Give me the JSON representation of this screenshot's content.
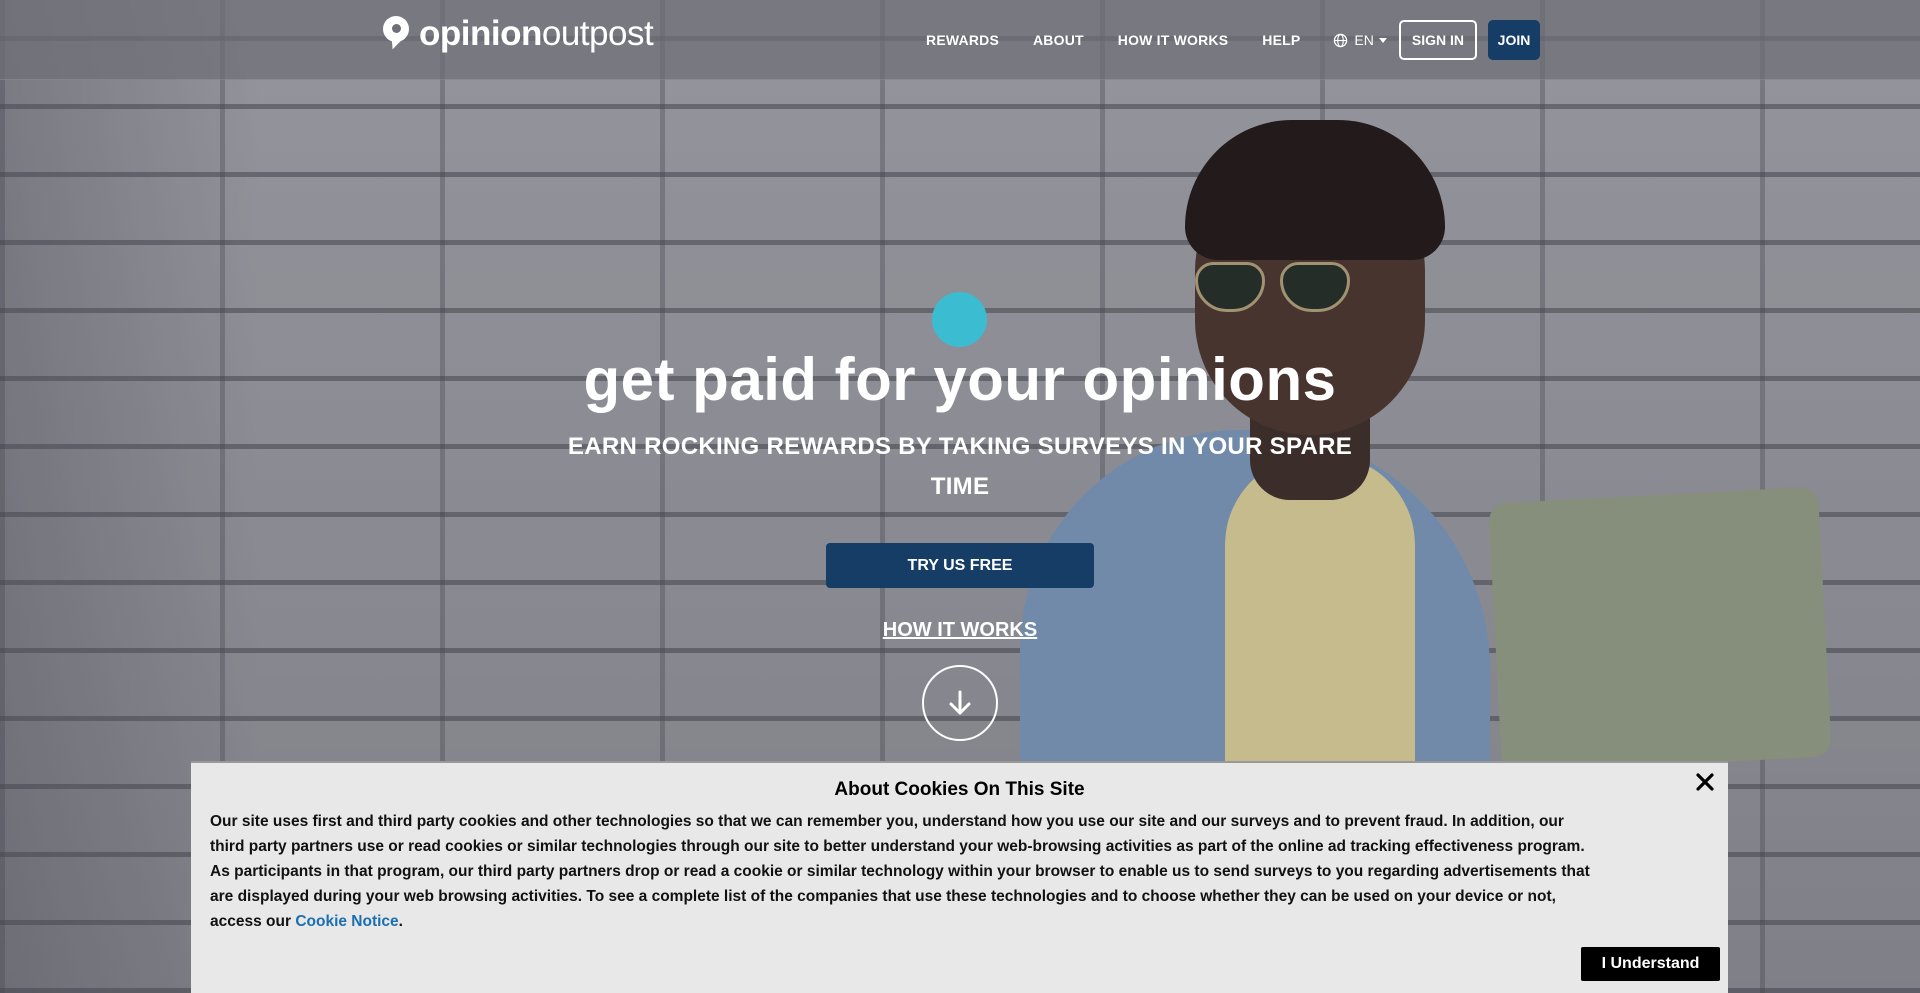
{
  "header": {
    "logo": {
      "bold": "opinion",
      "light": "outpost",
      "icon": "location-pin-icon"
    },
    "nav": [
      {
        "label": "REWARDS"
      },
      {
        "label": "ABOUT"
      },
      {
        "label": "HOW IT WORKS"
      },
      {
        "label": "HELP"
      }
    ],
    "language": {
      "label": "EN",
      "icon": "globe-icon"
    },
    "signin_label": "SIGN IN",
    "join_label": "JOIN"
  },
  "hero": {
    "title": "get paid for your opinions",
    "subtitle_line1": "EARN ROCKING REWARDS BY TAKING SURVEYS IN YOUR SPARE",
    "subtitle_line2": "TIME",
    "cta_label": "TRY US FREE",
    "how_it_works_label": "HOW IT WORKS",
    "scroll_icon": "arrow-down-icon",
    "accent_dot_color": "#3cbcd0",
    "button_color": "#163d66"
  },
  "cookie_banner": {
    "title": "About Cookies On This Site",
    "body": "Our site uses first and third party cookies and other technologies so that we can remember you, understand how you use our site and our surveys and to prevent fraud. In addition, our third party partners use or read cookies or similar technologies through our site to better understand your web-browsing activities as part of the online ad tracking effectiveness program. As participants in that program, our third party partners drop or read a cookie or similar technology within your browser to enable us to send surveys to you regarding advertisements that are displayed during your web browsing activities. To see a complete list of the companies that use these technologies and to choose whether they can be used on your device or not, access our ",
    "link_label": "Cookie Notice",
    "period": ".",
    "accept_label": "I Understand",
    "close_icon": "close-icon",
    "link_color": "#1a6fb0"
  }
}
